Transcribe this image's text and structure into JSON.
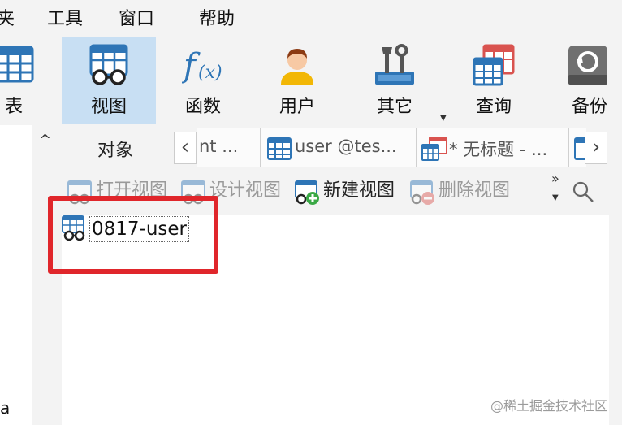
{
  "menubar": {
    "items": [
      {
        "label": "夹"
      },
      {
        "label": "工具"
      },
      {
        "label": "窗口"
      },
      {
        "label": "帮助"
      }
    ]
  },
  "toolbar": {
    "items": [
      {
        "label": "表",
        "icon": "table-icon"
      },
      {
        "label": "视图",
        "icon": "view-icon",
        "active": true
      },
      {
        "label": "函数",
        "icon": "function-icon"
      },
      {
        "label": "用户",
        "icon": "user-icon"
      },
      {
        "label": "其它",
        "icon": "tools-icon"
      },
      {
        "label": "查询",
        "icon": "query-icon"
      },
      {
        "label": "备份",
        "icon": "backup-icon"
      }
    ]
  },
  "sidebar": {
    "letter": "a"
  },
  "tabs": {
    "objects_label": "对象",
    "items": [
      {
        "label": "nt ..."
      },
      {
        "label": "user @tes..."
      },
      {
        "label": "* 无标题 - ..."
      }
    ]
  },
  "actions": {
    "open_view": "打开视图",
    "design_view": "设计视图",
    "new_view": "新建视图",
    "delete_view": "删除视图",
    "more": "»"
  },
  "objects": [
    {
      "name": "0817-user"
    }
  ],
  "watermark": "@稀土掘金技术社区",
  "colors": {
    "active_tool_bg": "#c8dff3",
    "highlight": "#e0262b",
    "icon_blue": "#2e75b6",
    "icon_red": "#d9534f"
  }
}
